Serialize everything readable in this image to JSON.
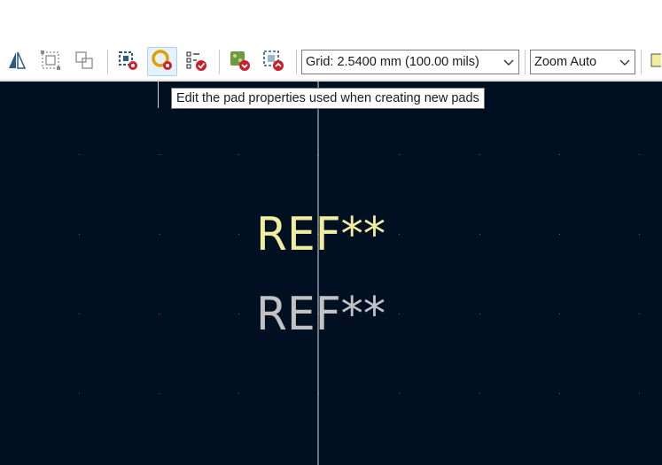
{
  "toolbar": {
    "grid_select": {
      "value": "Grid: 2.5400 mm (100.00 mils)"
    },
    "zoom_select": {
      "value": "Zoom Auto"
    },
    "buttons": [
      {
        "name": "mirror-tool",
        "icon": "mirror-icon"
      },
      {
        "name": "select-area",
        "icon": "selection-box-icon"
      },
      {
        "name": "group-tool",
        "icon": "group-icon"
      },
      {
        "name": "footprint-properties",
        "icon": "footprint-settings-icon"
      },
      {
        "name": "default-pad-properties",
        "icon": "pad-settings-icon"
      },
      {
        "name": "footprint-checker",
        "icon": "checklist-icon"
      },
      {
        "name": "load-from-board",
        "icon": "board-download-icon"
      },
      {
        "name": "update-board",
        "icon": "board-upload-icon"
      }
    ]
  },
  "tooltip": {
    "text": "Edit the pad properties used when creating new pads"
  },
  "canvas": {
    "background_color": "#001023",
    "ref_silkscreen": {
      "text": "REF**",
      "color": "#f2ec9f"
    },
    "ref_fab": {
      "text": "REF**",
      "color": "#c2c2c2"
    }
  }
}
